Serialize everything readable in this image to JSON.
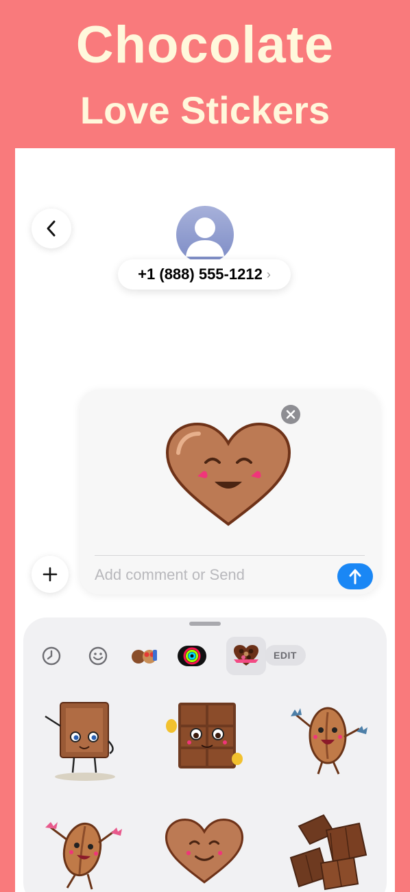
{
  "headline": {
    "line1": "Chocolate",
    "line2": "Love Stickers"
  },
  "header": {
    "contact_number": "+1 (888) 555-1212",
    "chevron": "›"
  },
  "compose": {
    "placeholder": "Add comment or Send"
  },
  "drawer": {
    "edit_label": "EDIT"
  },
  "icons": {
    "back": "chevron-left-icon",
    "remove": "close-icon",
    "send": "arrow-up-icon",
    "add": "plus-icon",
    "recents": "clock-icon",
    "emoji": "smiley-icon"
  },
  "colors": {
    "background": "#F97A7C",
    "headline": "#FFF8DC",
    "send_button": "#1A87F5",
    "chocolate": "#B97A52"
  }
}
